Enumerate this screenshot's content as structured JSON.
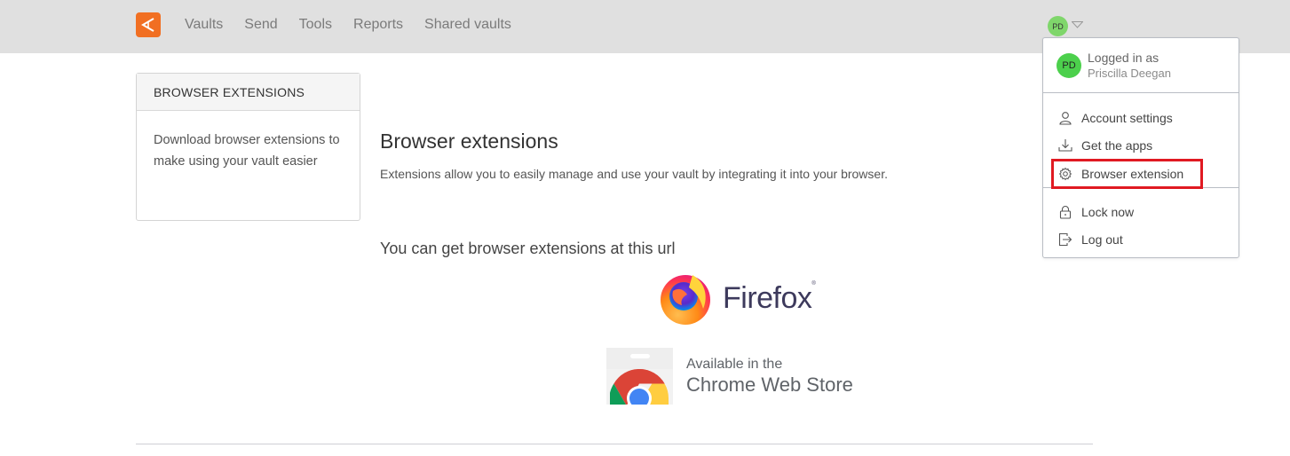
{
  "nav": {
    "logo": "app-logo",
    "items": [
      {
        "label": "Vaults"
      },
      {
        "label": "Send"
      },
      {
        "label": "Tools"
      },
      {
        "label": "Reports"
      },
      {
        "label": "Shared vaults"
      }
    ],
    "user_initials": "PD"
  },
  "sidebar": {
    "header": "BROWSER EXTENSIONS",
    "body": "Download browser extensions to make using your vault easier"
  },
  "main": {
    "title": "Browser extensions",
    "description": "Extensions allow you to easily manage and use your vault by integrating it into your browser.",
    "subtitle": "You can get browser extensions at this url",
    "firefox": {
      "label": "Firefox",
      "mark": "®"
    },
    "chrome": {
      "line1": "Available in the",
      "line2": "Chrome Web Store"
    }
  },
  "dropdown": {
    "logged_in_label": "Logged in as",
    "user_name": "Priscilla Deegan",
    "user_initials": "PD",
    "items": [
      {
        "label": "Account settings",
        "icon": "user-icon"
      },
      {
        "label": "Get the apps",
        "icon": "download-icon"
      },
      {
        "label": "Browser extension",
        "icon": "gear-icon",
        "highlighted": true
      },
      {
        "label": "Lock now",
        "icon": "lock-icon"
      },
      {
        "label": "Log out",
        "icon": "logout-icon"
      }
    ]
  },
  "colors": {
    "brand": "#f16f22",
    "highlight": "#e01a22",
    "avatar": "#4cd04c"
  }
}
